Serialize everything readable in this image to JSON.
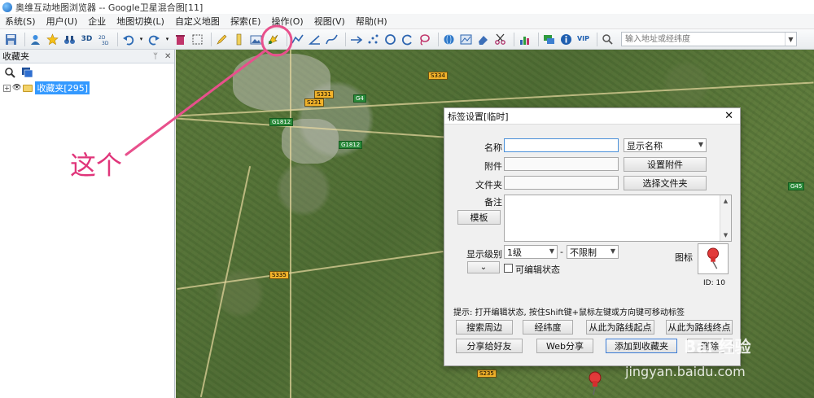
{
  "window": {
    "title": "奥维互动地图浏览器 -- Google卫星混合图[11]"
  },
  "menu": [
    "系统(S)",
    "用户(U)",
    "企业",
    "地图切换(L)",
    "自定义地图",
    "探索(E)",
    "操作(O)",
    "视图(V)",
    "帮助(H)"
  ],
  "toolbar": {
    "search_placeholder": "输入地址或经纬度",
    "label_3d": "3D",
    "label_vip": "VIP"
  },
  "panel": {
    "title": "收藏夹",
    "pin_glyph": "ᛘ",
    "close_glyph": "✕",
    "tree_root": "收藏夹[295]"
  },
  "annotation": {
    "text": "这个",
    "color": "#e0357a"
  },
  "dialog": {
    "title": "标签设置[临时]",
    "labels": {
      "name": "名称",
      "attachment": "附件",
      "folder": "文件夹",
      "note": "备注",
      "level": "显示级别",
      "icon": "图标",
      "editable": "可编辑状态",
      "level_sep": "-"
    },
    "buttons": {
      "display_name": "显示名称",
      "set_attachment": "设置附件",
      "choose_folder": "选择文件夹",
      "template": "模板",
      "search_nearby": "搜索周边",
      "latlon": "经纬度",
      "route_start": "从此为路线起点",
      "route_end": "从此为路线终点",
      "share_friend": "分享给好友",
      "web_share": "Web分享",
      "add_favorite": "添加到收藏夹",
      "delete": "删除"
    },
    "level_from": "1级",
    "level_to": "不限制",
    "icon_id": "ID: 10",
    "hint": "提示: 打开编辑状态, 按住Shift键+鼠标左键或方向键可移动标签"
  },
  "map_labels": [
    "S334",
    "S331",
    "S231",
    "G4",
    "G1812",
    "S335",
    "G45",
    "S235",
    "G1812"
  ],
  "watermark": {
    "brand": "Bai 经验",
    "url": "jingyan.baidu.com"
  }
}
